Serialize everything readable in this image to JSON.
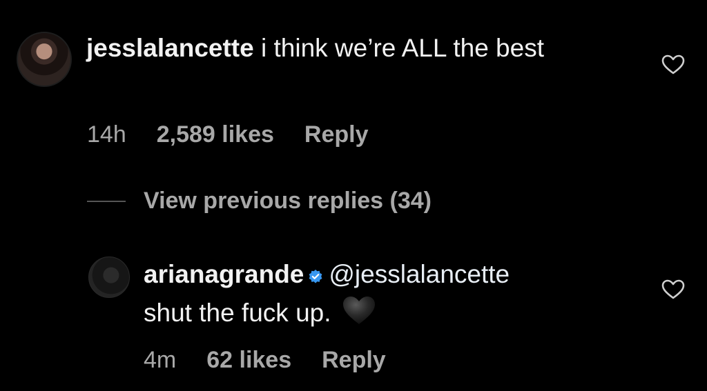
{
  "comment": {
    "username": "jesslalancette",
    "text": "i think we’re ALL the best",
    "time": "14h",
    "likes": "2,589 likes",
    "reply_label": "Reply",
    "avatar_icon": "profile-avatar-icon",
    "like_icon": "heart-outline-icon"
  },
  "view_previous": {
    "label": "View previous replies (34)"
  },
  "reply": {
    "username": "arianagrande",
    "verified_icon": "verified-badge-icon",
    "verified_color": "#3897f0",
    "mention": "@jesslalancette",
    "text": "shut the fuck up.",
    "emoji_icon": "black-heart-emoji-icon",
    "time": "4m",
    "likes": "62 likes",
    "reply_label": "Reply",
    "avatar_icon": "profile-avatar-icon",
    "like_icon": "heart-outline-icon"
  }
}
